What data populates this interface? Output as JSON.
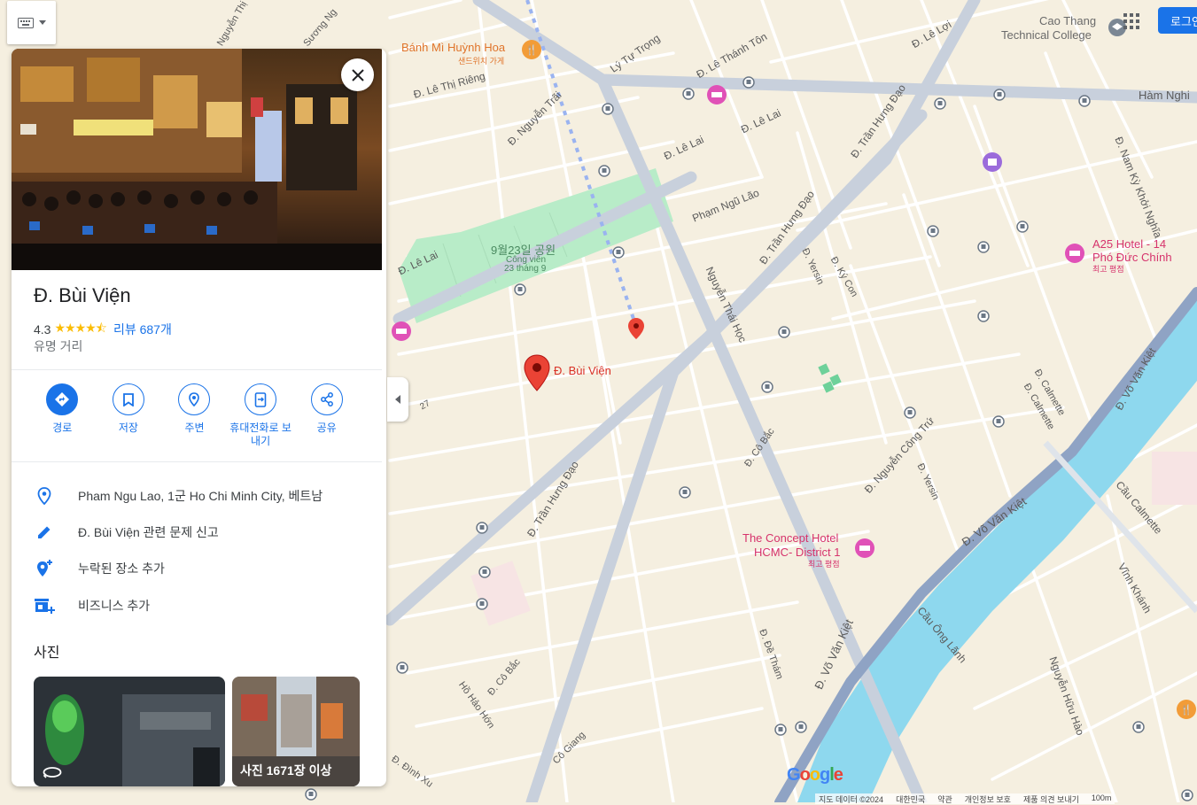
{
  "map": {
    "park_name": "9월23일 공원",
    "park_sub1": "Công viên",
    "park_sub2": "23 tháng 9",
    "marker_label": "Đ. Bùi Viện",
    "poi": {
      "banh_mi_name": "Bánh Mì Huỳnh Hoa",
      "banh_mi_sub": "샌드위치 가게",
      "cao_thang_1": "Cao Thang",
      "cao_thang_2": "Technical College",
      "a25_1": "A25 Hotel - 14",
      "a25_2": "Phó Đức Chính",
      "a25_sub": "최고 평점",
      "concept_1": "The Concept Hotel",
      "concept_2": "HCMC- District 1",
      "concept_sub": "최고 평점"
    },
    "streets": [
      "Lý Tự Trọng",
      "Đ. Lê Thánh Tôn",
      "Đ. Lê Lợi",
      "Đ. Lê Thị Riêng",
      "Đ. Nguyễn Trãi",
      "Đ. Lê Lai",
      "Đ. Lê Lai",
      "Đ. Trần Hưng Đạo",
      "Phạm Ngũ Lão",
      "Đ. Trần Hưng Đạo",
      "Hàm Nghi",
      "Đ. Nam Kỳ Khởi Nghĩa",
      "Đ. Lê Lai",
      "Nguyễn Thái Học",
      "Đ. Yersin",
      "Đ. Ký Con",
      "Đ. Calmette",
      "Đ. Calmette",
      "Đ. Võ Văn Kiệt",
      "Đ. Cô Bắc",
      "Đ. Nguyễn Công Trứ",
      "Đ. Yersin",
      "Đ. Võ Văn Kiệt",
      "Cầu Calmette",
      "Đ. Trần Hưng Đạo",
      "Cầu Ông Lãnh",
      "Vĩnh Khánh",
      "Đ. Đề Thám",
      "Đ. Võ Văn Kiệt",
      "Đ. Cô Bắc",
      "Hồ Hảo Hớn",
      "Cô Giang",
      "Nguyễn Hữu Hào",
      "Đ. Đình Xu",
      "Nguyễn Thị",
      "Sương Ng",
      "27"
    ]
  },
  "keyboard": {
    "icon": "keyboard-icon"
  },
  "place": {
    "image_alt": "Bui Vien street at night",
    "name": "Đ. Bùi Viện",
    "rating": "4.3",
    "stars": "★★★★⯪",
    "reviews": "리뷰 687개",
    "category": "유명 거리"
  },
  "actions": [
    {
      "label": "경로",
      "icon": "directions-icon"
    },
    {
      "label": "저장",
      "icon": "bookmark-icon"
    },
    {
      "label": "주변",
      "icon": "nearby-icon"
    },
    {
      "label": "휴대전화로 보내기",
      "icon": "send-to-phone-icon"
    },
    {
      "label": "공유",
      "icon": "share-icon"
    }
  ],
  "info": {
    "address": "Pham Ngu Lao, 1군 Ho Chi Minh City, 베트남",
    "report": "Đ. Bùi Viện 관련 문제 신고",
    "add_place": "누락된 장소 추가",
    "add_business": "비즈니스 추가"
  },
  "photos": {
    "heading": "사진",
    "more_label": "사진 1671장 이상"
  },
  "header": {
    "login": "로그인"
  },
  "footer": {
    "map_data": "지도 데이터 ©2024",
    "country": "대한민국",
    "terms": "약관",
    "privacy": "개인정보 보호",
    "feedback": "제품 의견 보내기",
    "scale": "100m"
  },
  "colors": {
    "accent": "#1a73e8",
    "map_bg": "#f5efe0",
    "park": "#b8ecc8",
    "water": "#8ed8ee",
    "road_major": "#c8d0dc",
    "marker": "#ea4335"
  }
}
